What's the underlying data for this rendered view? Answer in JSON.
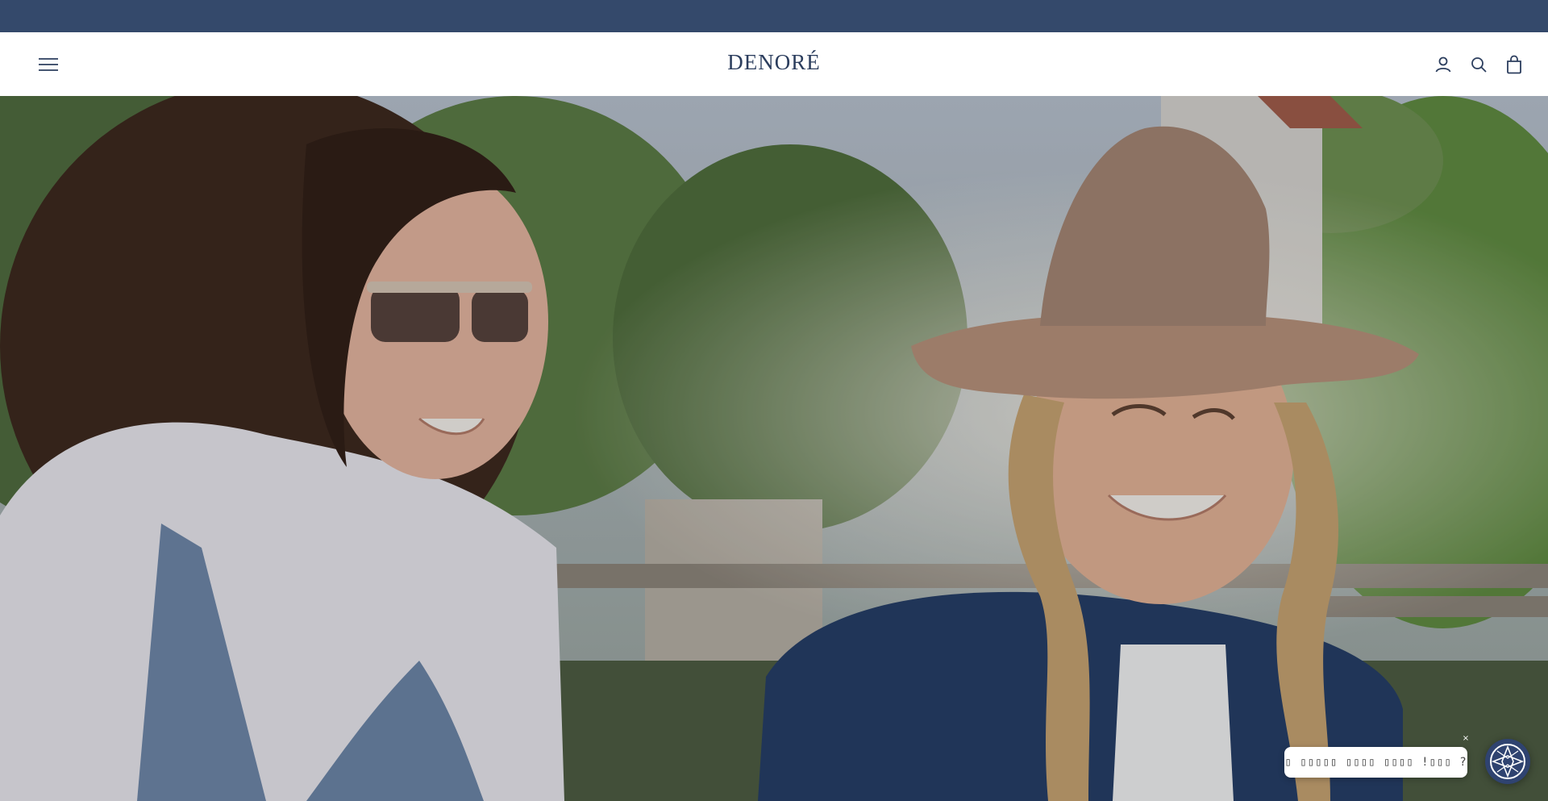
{
  "header": {
    "brand": "DENORÉ",
    "menu_icon": "hamburger-menu-icon",
    "account_icon": "account-icon",
    "search_icon": "search-icon",
    "cart_icon": "shopping-bag-icon"
  },
  "colors": {
    "announcement_bar": "#34496b",
    "brand_text": "#2c3e5e",
    "chat_launcher": "#2f4370"
  },
  "chat_widget": {
    "bubble_text": "▯▯ ▯▯▯▯▯ ▯▯▯▯ ▯▯▯▯ !▯▯▯ ?▯",
    "close_label": "×",
    "launcher_icon": "chat-logo-icon"
  }
}
